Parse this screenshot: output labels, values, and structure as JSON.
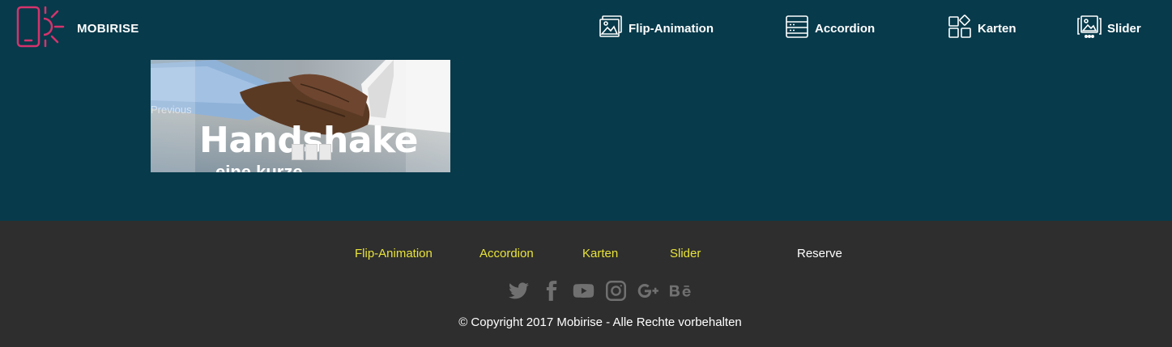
{
  "brand": {
    "name": "MOBIRISE",
    "logo_icon": "phone-sun-icon"
  },
  "nav": [
    {
      "label": "Flip-Animation",
      "icon": "image-gallery-icon"
    },
    {
      "label": "Accordion",
      "icon": "server-list-icon"
    },
    {
      "label": "Karten",
      "icon": "grid-cards-icon"
    },
    {
      "label": "Slider",
      "icon": "image-slider-icon"
    }
  ],
  "slider": {
    "title": "Handshake",
    "subtitle": "eine kurze",
    "prev_label": "Previous",
    "indicator_count": 3
  },
  "footer": {
    "links": [
      "Flip-Animation",
      "Accordion",
      "Karten",
      "Slider"
    ],
    "reserve_label": "Reserve",
    "social": [
      "twitter-icon",
      "facebook-icon",
      "youtube-icon",
      "instagram-icon",
      "google-plus-icon",
      "behance-icon"
    ],
    "copyright": "© Copyright 2017 Mobirise - Alle Rechte vorbehalten",
    "link_color": "#e8e33a"
  },
  "colors": {
    "header_bg": "#073a4b",
    "footer_bg": "#2e2e2e",
    "logo_accent": "#d6336c"
  }
}
